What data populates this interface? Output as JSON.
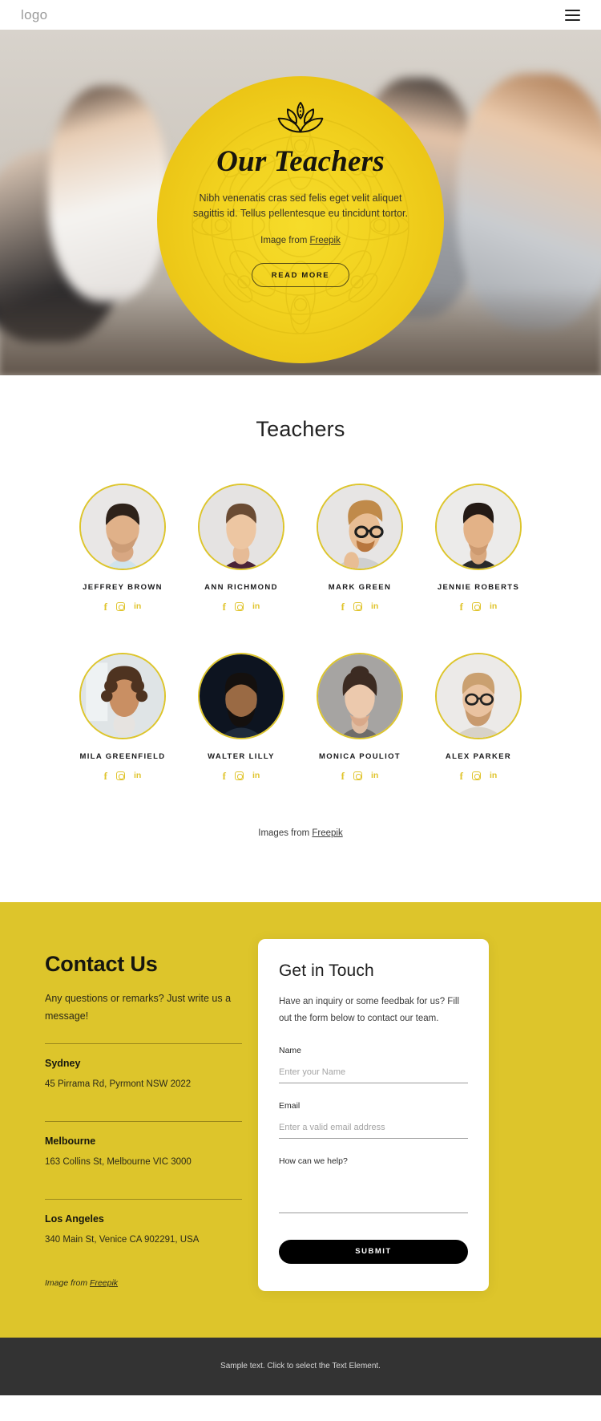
{
  "header": {
    "logo": "logo",
    "menu_icon": "hamburger-menu-icon"
  },
  "hero": {
    "lotus_icon": "lotus-flower-icon",
    "title": "Our Teachers",
    "paragraph": "Nibh venenatis cras sed felis eget velit aliquet sagittis id. Tellus pellentesque eu tincidunt tortor.",
    "credit_prefix": "Image from ",
    "credit_link": "Freepik",
    "button": "READ MORE"
  },
  "teachers": {
    "heading": "Teachers",
    "social_labels": {
      "facebook": "f",
      "instagram": "instagram-icon",
      "linkedin": "in"
    },
    "people": [
      {
        "name": "JEFFREY BROWN"
      },
      {
        "name": "ANN RICHMOND"
      },
      {
        "name": "MARK GREEN"
      },
      {
        "name": "JENNIE ROBERTS"
      },
      {
        "name": "MILA GREENFIELD"
      },
      {
        "name": "WALTER LILLY"
      },
      {
        "name": "MONICA POULIOT"
      },
      {
        "name": "ALEX PARKER"
      }
    ],
    "credit_prefix": "Images from ",
    "credit_link": "Freepik"
  },
  "contact": {
    "heading": "Contact Us",
    "subtitle": "Any questions or remarks? Just write us a message!",
    "offices": [
      {
        "city": "Sydney",
        "address": "45 Pirrama Rd, Pyrmont NSW 2022"
      },
      {
        "city": "Melbourne",
        "address": "163 Collins St, Melbourne VIC 3000"
      },
      {
        "city": "Los Angeles",
        "address": "340 Main St, Venice CA 902291, USA"
      }
    ],
    "credit_prefix": "Image from ",
    "credit_link": "Freepik"
  },
  "form": {
    "heading": "Get in Touch",
    "description": "Have an inquiry or some feedbak for us? Fill out the form below to contact our team.",
    "name_label": "Name",
    "name_placeholder": "Enter your Name",
    "name_value": "",
    "email_label": "Email",
    "email_placeholder": "Enter a valid email address",
    "email_value": "",
    "message_label": "How can we help?",
    "message_placeholder": "",
    "message_value": "",
    "submit": "SUBMIT"
  },
  "footer": {
    "text": "Sample text. Click to select the Text Element."
  },
  "colors": {
    "yellow": "#ddc52b",
    "hero_yellow": "#f2d21f",
    "dark": "#333333"
  }
}
